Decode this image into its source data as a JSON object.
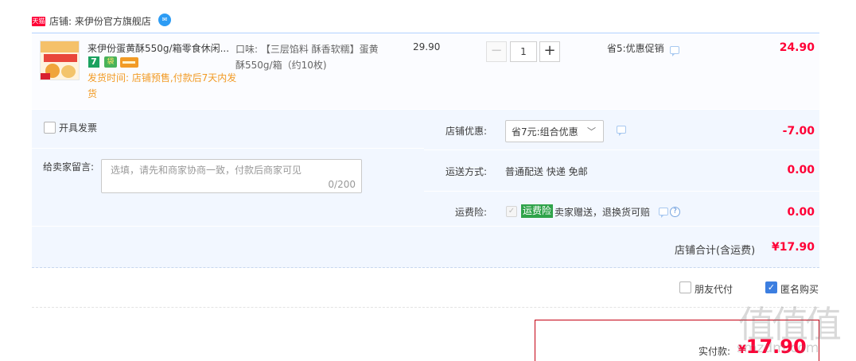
{
  "store": {
    "badge": "天猫",
    "label": "店铺: 来伊份官方旗舰店",
    "chat_icon": "wangwang-icon"
  },
  "item": {
    "title": "来伊份蛋黄酥550g/箱零食休闲...",
    "ship_time": "发货时间: 店铺预售,付款后7天内发货",
    "sku": "口味: 【三层馅料 酥香软糯】蛋黄酥550g/箱（约10枚)",
    "unit_price": "29.90",
    "quantity": "1",
    "minus": "−",
    "plus": "+",
    "promo": "省5:优惠促销",
    "total": "24.90",
    "service_icons": [
      "7-day-return-icon",
      "shopping-bag-icon",
      "credit-card-icon"
    ]
  },
  "invoice": {
    "label": "开具发票",
    "checked": false
  },
  "message": {
    "label": "给卖家留言:",
    "placeholder": "选填，请先和商家协商一致，付款后商家可见",
    "count": "0/200"
  },
  "discount": {
    "label": "店铺优惠:",
    "selected": "省7元:组合优惠",
    "amount": "-7.00"
  },
  "shipping": {
    "label": "运送方式:",
    "text": "普通配送 快递 免邮",
    "amount": "0.00"
  },
  "insurance": {
    "label": "运费险:",
    "tag": "运费险",
    "text": "卖家赠送，退换货可赔",
    "amount": "0.00"
  },
  "store_total": {
    "label": "店铺合计(含运费)",
    "amount": "¥17.90"
  },
  "options": {
    "friend_pay": {
      "label": "朋友代付",
      "checked": false
    },
    "anonymous": {
      "label": "匿名购买",
      "checked": true
    }
  },
  "pay": {
    "label": "实付款:",
    "currency": "¥",
    "amount": "17.90"
  },
  "watermark": {
    "glyphs": "值值值",
    "url": "smzdm.com"
  },
  "colors": {
    "price_red": "#ff0036",
    "ship_orange": "#f29b26",
    "panel_blue": "#f2f7ff",
    "insurance_green": "#2fa34a",
    "checkbox_blue": "#3c7ee0"
  }
}
